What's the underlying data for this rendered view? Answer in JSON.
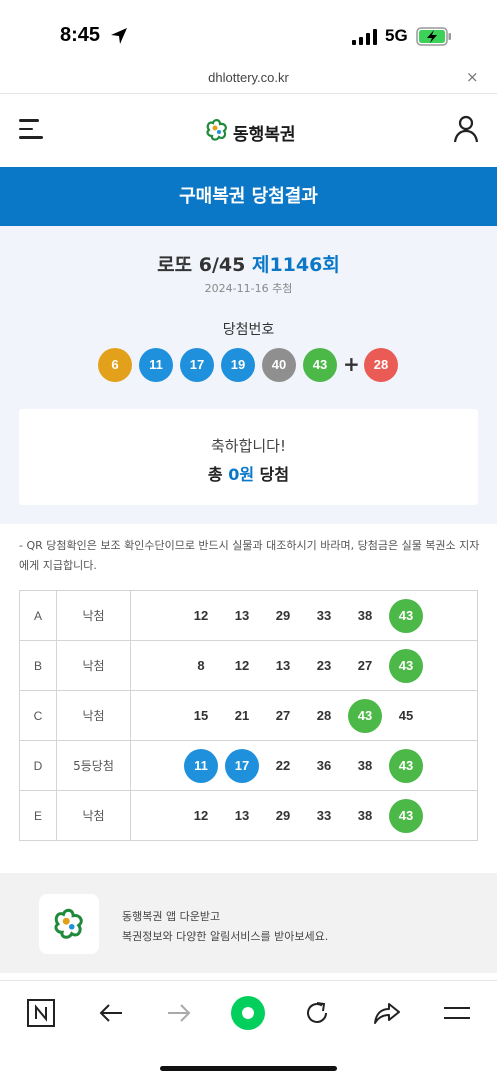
{
  "status_bar": {
    "time": "8:45",
    "network": "5G"
  },
  "url_bar": {
    "url": "dhlottery.co.kr",
    "close": "×"
  },
  "header": {
    "logo_text": "동행복권"
  },
  "banner": {
    "title": "구매복권 당첨결과"
  },
  "draw": {
    "game": "로또 6/45",
    "round": "제1146회",
    "date": "2024-11-16 추첨",
    "win_label": "당첨번호",
    "numbers": [
      "6",
      "11",
      "17",
      "19",
      "40",
      "43"
    ],
    "plus": "+",
    "bonus": "28"
  },
  "congrats": {
    "message": "축하합니다!",
    "total_prefix": "총 ",
    "total_amount": "0원",
    "total_suffix": " 당첨"
  },
  "notice": "- QR 당첨확인은 보조 확인수단이므로 반드시 실물과 대조하시기 바라며, 당첨금은 실물 복권소 지자에게 지급합니다.",
  "tickets": [
    {
      "slot": "A",
      "rank": "낙첨",
      "numbers": [
        "12",
        "13",
        "29",
        "33",
        "38",
        "43"
      ]
    },
    {
      "slot": "B",
      "rank": "낙첨",
      "numbers": [
        "8",
        "12",
        "13",
        "23",
        "27",
        "43"
      ]
    },
    {
      "slot": "C",
      "rank": "낙첨",
      "numbers": [
        "15",
        "21",
        "27",
        "28",
        "43",
        "45"
      ]
    },
    {
      "slot": "D",
      "rank": "5등당첨",
      "numbers": [
        "11",
        "17",
        "22",
        "36",
        "38",
        "43"
      ]
    },
    {
      "slot": "E",
      "rank": "낙첨",
      "numbers": [
        "12",
        "13",
        "29",
        "33",
        "38",
        "43"
      ]
    }
  ],
  "promo": {
    "line1": "동행복권 앱 다운받고",
    "line2": "복권정보와 다양한 알림서비스를 받아보세요."
  },
  "colors": {
    "brand_blue": "#0a78c7",
    "ball_1_10": "#e3a11b",
    "ball_11_20": "#1f90dc",
    "ball_21_30": "#ea5b55",
    "ball_31_40": "#8f8f8f",
    "ball_41_45": "#4cb848"
  },
  "toolbar": {
    "icons": [
      "naver-n-icon",
      "back-arrow-icon",
      "forward-arrow-icon",
      "green-home-icon",
      "reload-icon",
      "share-icon",
      "menu-icon"
    ]
  }
}
